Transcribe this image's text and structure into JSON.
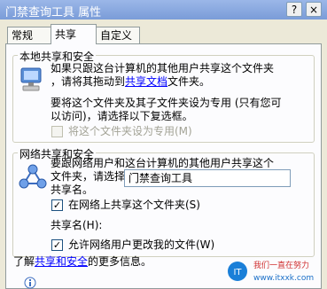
{
  "window": {
    "title": "门禁查询工具  属性",
    "help_button": "?",
    "close_button": "×"
  },
  "tabs": [
    {
      "label": "常规"
    },
    {
      "label": "共享"
    },
    {
      "label": "自定义"
    }
  ],
  "local": {
    "heading": "本地共享和安全",
    "desc_line1": "如果只跟这台计算机的其他用户共享这个文件夹",
    "desc_line2_pre": "，请将其拖动到",
    "desc_line2_link": "共享文档",
    "desc_line2_post": "文件夹。",
    "private_line1": "要将这个文件夹及其子文件夹设为专用 (只有您可",
    "private_line2": "以访问)，请选择以下复选框。",
    "private_checkbox": "将这个文件夹设为专用(M)"
  },
  "network": {
    "heading": "网络共享和安全",
    "desc_line1": "要跟网络用户和这台计算机的其他用户共享这个",
    "desc_line2": "文件夹，请选择下面的第一个复选框，键入一个",
    "desc_line3": "共享名。",
    "share_checkbox": "在网络上共享这个文件夹(S)",
    "share_name_label": "共享名(H):",
    "share_name_value": "门禁查询工具",
    "allow_change_checkbox": "允许网络用户更改我的文件(W)",
    "check_mark": "✓"
  },
  "footer": {
    "pre": "了解",
    "link": "共享和安全",
    "post": "的更多信息。"
  },
  "watermark": {
    "line1": "我们一直在努力",
    "line2": "www.itxxk.com"
  },
  "colors": {
    "titlebar": "#8aa9df",
    "link": "#0000ff",
    "face": "#ece9d8"
  }
}
